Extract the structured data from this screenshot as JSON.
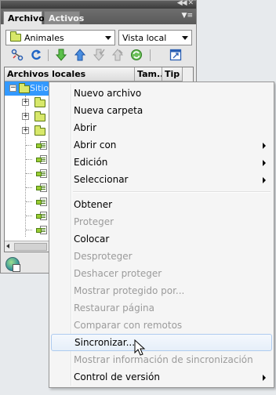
{
  "panel": {
    "tabs": [
      {
        "label": "Archivos",
        "active": true
      },
      {
        "label": "Activos",
        "active": false
      }
    ],
    "site_select": {
      "value": "Animales",
      "icon": "folder-icon"
    },
    "view_select": {
      "value": "Vista local"
    },
    "toolbar": {
      "buttons": [
        {
          "name": "connect-icon"
        },
        {
          "name": "refresh-icon"
        },
        {
          "name": "get-files-icon"
        },
        {
          "name": "put-files-icon"
        },
        {
          "name": "check-out-icon",
          "disabled": true
        },
        {
          "name": "check-in-icon",
          "disabled": true
        },
        {
          "name": "synchronize-icon"
        },
        {
          "name": "expand-panel-icon"
        }
      ]
    },
    "file_list": {
      "columns": [
        "Archivos locales",
        "Tam...",
        "Tip"
      ],
      "rows": [
        {
          "type": "site-root",
          "label": "Sitio - Animales (C:\\..."
        },
        {
          "type": "folder",
          "label": ""
        },
        {
          "type": "folder",
          "label": ""
        },
        {
          "type": "folder",
          "label": ""
        },
        {
          "type": "file",
          "label": ""
        },
        {
          "type": "file",
          "label": ""
        },
        {
          "type": "file",
          "label": ""
        },
        {
          "type": "file",
          "label": ""
        },
        {
          "type": "file",
          "label": ""
        },
        {
          "type": "file",
          "label": ""
        },
        {
          "type": "file",
          "label": ""
        }
      ]
    }
  },
  "context_menu": {
    "items": [
      {
        "label": "Nuevo archivo",
        "disabled": false,
        "submenu": false
      },
      {
        "label": "Nueva carpeta",
        "disabled": false,
        "submenu": false
      },
      {
        "label": "Abrir",
        "disabled": false,
        "submenu": false
      },
      {
        "label": "Abrir con",
        "disabled": false,
        "submenu": true
      },
      {
        "label": "Edición",
        "disabled": false,
        "submenu": true
      },
      {
        "label": "Seleccionar",
        "disabled": false,
        "submenu": true
      },
      {
        "separator": true
      },
      {
        "label": "Obtener",
        "disabled": false,
        "submenu": false
      },
      {
        "label": "Proteger",
        "disabled": true,
        "submenu": false
      },
      {
        "label": "Colocar",
        "disabled": false,
        "submenu": false
      },
      {
        "label": "Desproteger",
        "disabled": true,
        "submenu": false
      },
      {
        "label": "Deshacer proteger",
        "disabled": true,
        "submenu": false
      },
      {
        "label": "Mostrar protegido por...",
        "disabled": true,
        "submenu": false
      },
      {
        "label": "Restaurar página",
        "disabled": true,
        "submenu": false
      },
      {
        "label": "Comparar con remotos",
        "disabled": true,
        "submenu": false
      },
      {
        "label": "Sincronizar...",
        "disabled": false,
        "submenu": false,
        "hover": true
      },
      {
        "label": "Mostrar información de sincronización",
        "disabled": true,
        "submenu": false
      },
      {
        "label": "Control de versión",
        "disabled": false,
        "submenu": true
      }
    ]
  },
  "colors": {
    "selection": "#3399ff",
    "folder": "#d8e86a",
    "menu_background": "#f5f5f5",
    "disabled_text": "#9b9b9b"
  }
}
